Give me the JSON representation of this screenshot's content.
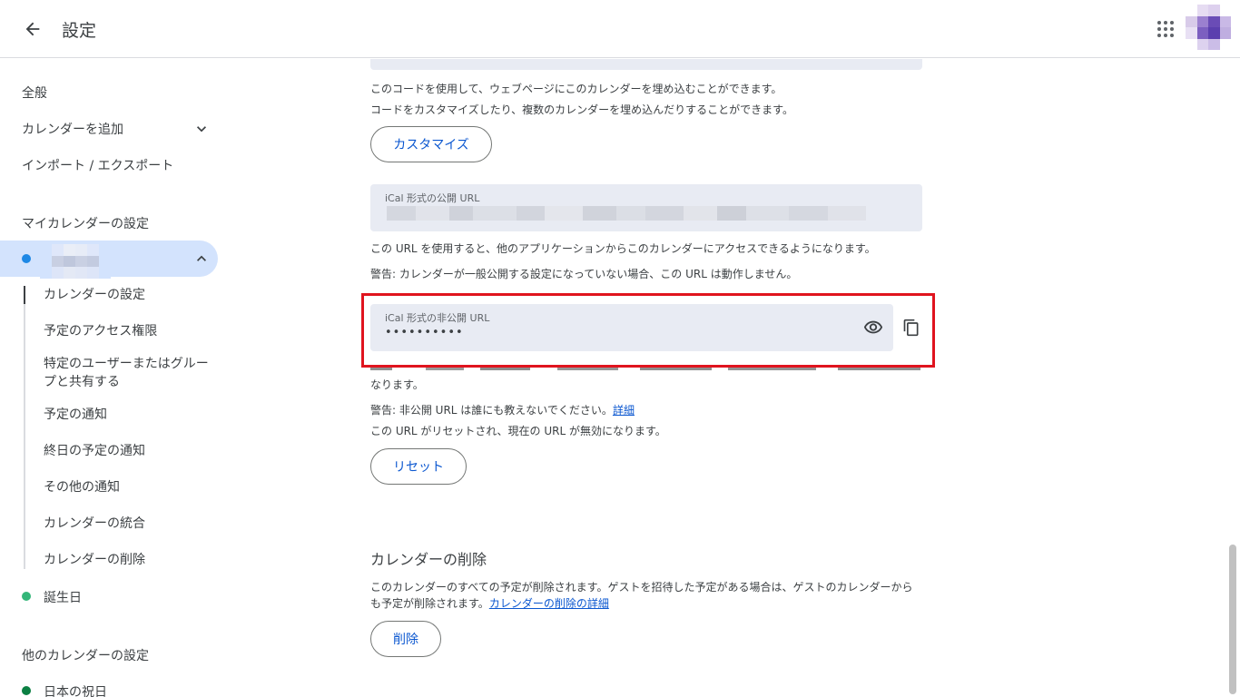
{
  "header": {
    "title": "設定",
    "back_icon": "arrow-back-icon",
    "apps_icon": "apps-grid-icon"
  },
  "sidebar": {
    "general": "全般",
    "add_calendar": "カレンダーを追加",
    "import_export": "インポート / エクスポート",
    "my_calendars_heading": "マイカレンダーの設定",
    "selected_calendar_color": "#1e88e5",
    "sub_items": [
      "カレンダーの設定",
      "予定のアクセス権限",
      "特定のユーザーまたはグループと共有する",
      "予定の通知",
      "終日の予定の通知",
      "その他の通知",
      "カレンダーの統合",
      "カレンダーの削除"
    ],
    "birthdays": "誕生日",
    "birthdays_color": "#33b679",
    "other_calendars_heading": "他のカレンダーの設定",
    "japan_holidays": "日本の祝日",
    "japan_holidays_color": "#0b8043"
  },
  "main": {
    "embed_desc_1": "このコードを使用して、ウェブページにこのカレンダーを埋め込むことができます。",
    "embed_desc_2": "コードをカスタマイズしたり、複数のカレンダーを埋め込んだりすることができます。",
    "customize_button": "カスタマイズ",
    "public_url_label": "iCal 形式の公開 URL",
    "public_url_desc": "この URL を使用すると、他のアプリケーションからこのカレンダーにアクセスできるようになります。",
    "public_url_warning": "警告: カレンダーが一般公開する設定になっていない場合、この URL は動作しません。",
    "private_url_label": "iCal 形式の非公開 URL",
    "private_url_value": "••••••••••",
    "private_url_desc_line2": "なります。",
    "private_warning": "警告: 非公開 URL は誰にも教えないでください。",
    "private_warning_link": "詳細",
    "reset_note": "この URL がリセットされ、現在の URL が無効になります。",
    "reset_button": "リセット",
    "delete_section_title": "カレンダーの削除",
    "delete_desc_1": "このカレンダーのすべての予定が削除されます。ゲストを招待した予定がある場合は、ゲストのカレンダーから",
    "delete_desc_2": "も予定が削除されます。",
    "delete_link": "カレンダーの削除の詳細",
    "delete_button": "削除",
    "highlight_color": "#e0141e"
  }
}
